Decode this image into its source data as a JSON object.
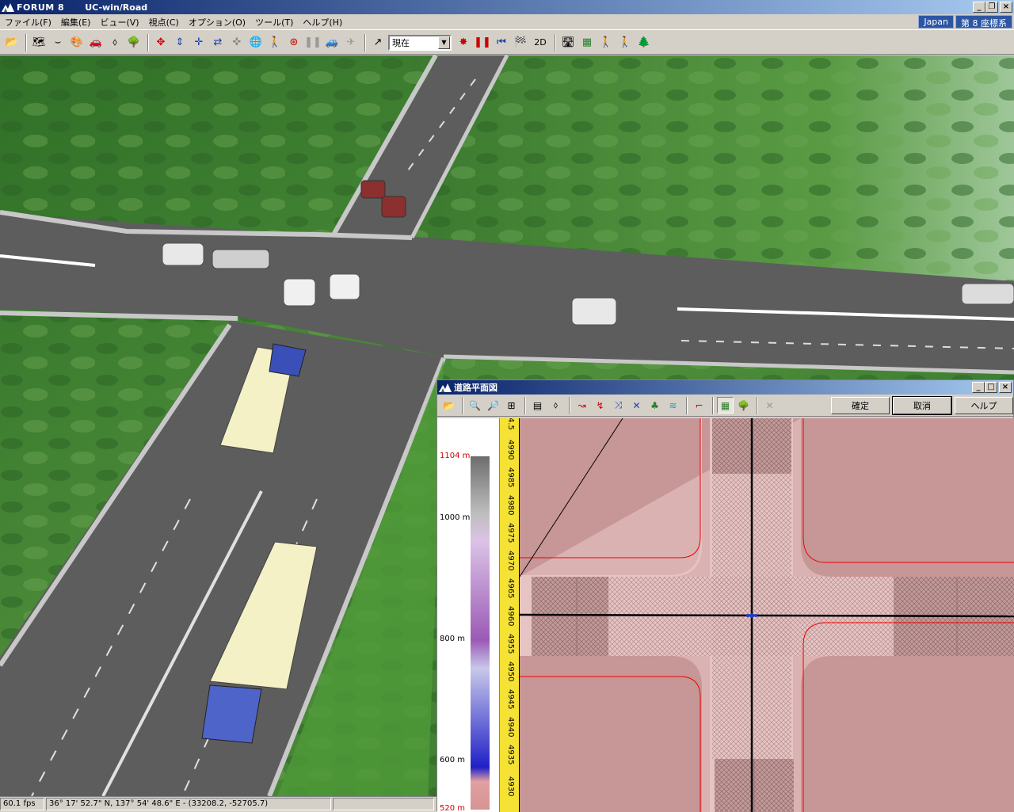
{
  "window": {
    "company": "FORUM 8",
    "app": "UC-win/Road"
  },
  "menu": {
    "items": [
      "ファイル(F)",
      "編集(E)",
      "ビュー(V)",
      "視点(C)",
      "オプション(O)",
      "ツール(T)",
      "ヘルプ(H)"
    ],
    "region": "Japan",
    "coord_system": "第 8 座標系"
  },
  "toolbar": {
    "viewpoint_value": "現在",
    "mode_2d": "2D"
  },
  "status": {
    "fps": "60.1 fps",
    "position": "36°  17' 52.7\" N, 137°  54' 48.6\" E  -   (33208.2, -52705.7)"
  },
  "plan_window": {
    "title": "道路平面図",
    "ok_label": "確定",
    "cancel_label": "取消",
    "help_label": "ヘルプ"
  },
  "elevation_legend": {
    "labels": [
      "1104 m",
      "1000 m",
      "800 m",
      "600 m",
      "520 m"
    ]
  },
  "ruler": {
    "labels": [
      "4.5",
      "4990",
      "4985",
      "4980",
      "4975",
      "4970",
      "4965",
      "4960",
      "4955",
      "4950",
      "4945",
      "4940",
      "4935",
      "4930"
    ]
  },
  "colors": {
    "title_start": "#0a246a",
    "title_end": "#a6caf0",
    "grass": "#3f7f2e",
    "road": "#5d5d5d",
    "plan_land": "#c79696",
    "plan_road": "#e7c4c4",
    "ruler": "#f5e234"
  }
}
